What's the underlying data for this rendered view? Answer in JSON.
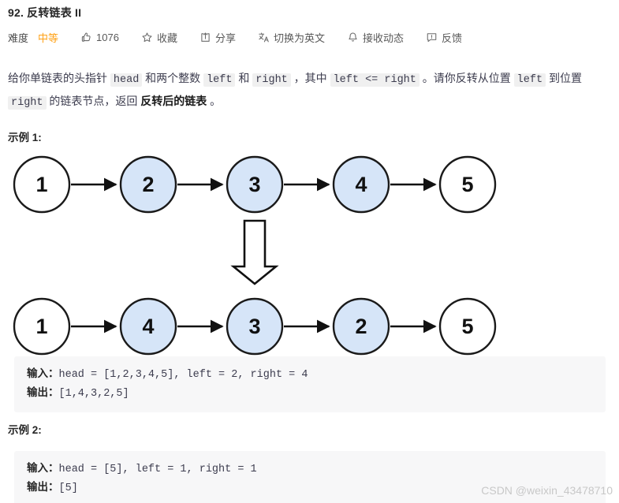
{
  "header": {
    "title": "92. 反转链表 II",
    "difficulty_label": "难度",
    "difficulty_value": "中等",
    "difficulty_color": "#ffa116",
    "likes_count": "1076",
    "favorite_label": "收藏",
    "share_label": "分享",
    "translate_label": "切换为英文",
    "subscribe_label": "接收动态",
    "feedback_label": "反馈",
    "icons": {
      "like": "thumbs-up-icon",
      "favorite": "star-icon",
      "share": "share-box-icon",
      "translate": "language-icon",
      "subscribe": "bell-icon",
      "feedback": "comment-icon"
    }
  },
  "description": {
    "part1": "给你单链表的头指针 ",
    "code1": "head",
    "part2": " 和两个整数 ",
    "code2": "left",
    "part3": " 和 ",
    "code3": "right",
    "part4": " ，其中 ",
    "code4": "left <= right",
    "part5": " 。请你反转从位置 ",
    "code5": "left",
    "part6": " 到位置 ",
    "code6": "right",
    "part7": " 的链表节点，返回 ",
    "bold1": "反转后的链表",
    "part8": " 。"
  },
  "examples": [
    {
      "heading": "示例 1:",
      "input_label": "输入：",
      "input_value": "head = [1,2,3,4,5], left = 2, right = 4",
      "output_label": "输出：",
      "output_value": "[1,4,3,2,5]"
    },
    {
      "heading": "示例 2:",
      "input_label": "输入：",
      "input_value": "head = [5], left = 1, right = 1",
      "output_label": "输出：",
      "output_value": "[5]"
    }
  ],
  "diagram": {
    "node_fill_highlight": "#d6e5f8",
    "node_fill_plain": "#ffffff",
    "node_stroke": "#1a1a1a",
    "before": {
      "values": [
        "1",
        "2",
        "3",
        "4",
        "5"
      ],
      "highlighted": [
        false,
        true,
        true,
        true,
        false
      ]
    },
    "after": {
      "values": [
        "1",
        "4",
        "3",
        "2",
        "5"
      ],
      "highlighted": [
        false,
        true,
        true,
        true,
        false
      ]
    },
    "transform_arrow": "down-block-arrow"
  },
  "watermark": "CSDN @weixin_43478710"
}
